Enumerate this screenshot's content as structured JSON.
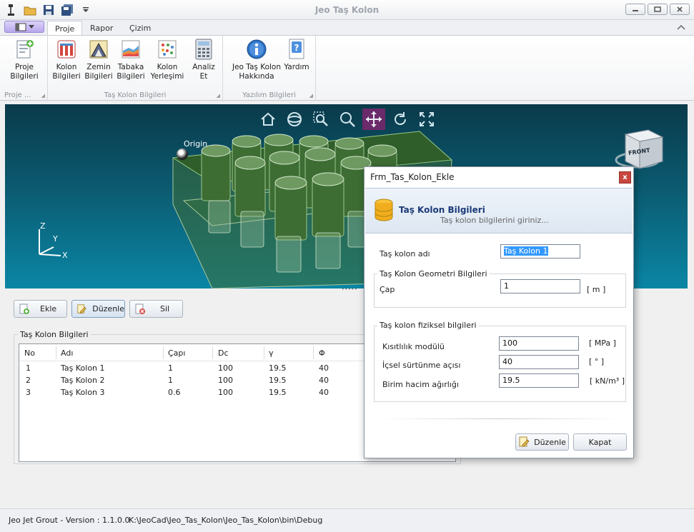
{
  "window": {
    "title": "Jeo Taş Kolon",
    "controls": [
      "minimize",
      "maximize",
      "close"
    ]
  },
  "ribbon": {
    "tabs": [
      {
        "label": "Proje",
        "active": true
      },
      {
        "label": "Rapor",
        "active": false
      },
      {
        "label": "Çizim",
        "active": false
      }
    ],
    "groups": [
      {
        "label": "Proje ...",
        "buttons": [
          {
            "label": "Proje\nBilgileri",
            "icon": "project-info-icon"
          }
        ]
      },
      {
        "label": "Taş Kolon Bilgileri",
        "buttons": [
          {
            "label": "Kolon\nBilgileri",
            "icon": "column-info-icon"
          },
          {
            "label": "Zemin\nBilgileri",
            "icon": "soil-info-icon"
          },
          {
            "label": "Tabaka\nBilgileri",
            "icon": "layer-info-icon"
          },
          {
            "label": "Kolon\nYerleşimi",
            "icon": "column-layout-icon"
          },
          {
            "label": "Analiz\nEt",
            "icon": "analyze-icon"
          }
        ]
      },
      {
        "label": "Yazılım Bilgileri",
        "buttons": [
          {
            "label": "Jeo Taş Kolon\nHakkında",
            "icon": "about-icon"
          },
          {
            "label": "Yardım",
            "icon": "help-icon"
          }
        ]
      }
    ]
  },
  "viewport": {
    "origin_label": "Origin",
    "axes": {
      "z": "Z",
      "y": "Y",
      "x": "X"
    },
    "viewcube_label": "FRONT",
    "toolbar": [
      "home-icon",
      "orbit-icon",
      "zoom-window-icon",
      "zoom-icon",
      "pan-icon",
      "rotate-icon",
      "fit-icon"
    ],
    "active_tool": "pan-icon"
  },
  "actions": {
    "add": "Ekle",
    "edit": "Düzenle",
    "delete": "Sil"
  },
  "table": {
    "title": "Taş Kolon Bilgileri",
    "columns": [
      "No",
      "Adı",
      "Çapı",
      "Dc",
      "γ",
      "Φ"
    ],
    "rows": [
      [
        "1",
        "Taş Kolon 1",
        "1",
        "100",
        "19.5",
        "40"
      ],
      [
        "2",
        "Taş Kolon 2",
        "1",
        "100",
        "19.5",
        "40"
      ],
      [
        "3",
        "Taş Kolon 3",
        "0.6",
        "100",
        "19.5",
        "40"
      ]
    ]
  },
  "status": {
    "version": "Jeo Jet Grout - Version : 1.1.0.0",
    "path": "K:\\JeoCad\\Jeo_Tas_Kolon\\Jeo_Tas_Kolon\\bin\\Debug"
  },
  "dialog": {
    "title": "Frm_Tas_Kolon_Ekle",
    "close": "x",
    "header_title": "Taş Kolon Bilgileri",
    "header_subtitle": "Taş kolon  bilgilerini giriniz...",
    "name_label": "Taş kolon adı",
    "name_value": "Taş Kolon 1",
    "geometry_legend": "Taş Kolon Geometri Bilgileri",
    "diameter_label": "Çap",
    "diameter_value": "1",
    "diameter_unit": "[ m ]",
    "physical_legend": "Taş kolon fiziksel bilgileri",
    "modulus_label": "Kısıtlılık modülü",
    "modulus_value": "100",
    "modulus_unit": "[ MPa ]",
    "friction_label": "İçsel sürtünme açısı",
    "friction_value": "40",
    "friction_unit": "[ ° ]",
    "unit_weight_label": "Birim hacim ağırlığı",
    "unit_weight_value": "19.5",
    "unit_weight_unit": "[ kN/m³ ]",
    "edit_button": "Düzenle",
    "close_button": "Kapat"
  }
}
